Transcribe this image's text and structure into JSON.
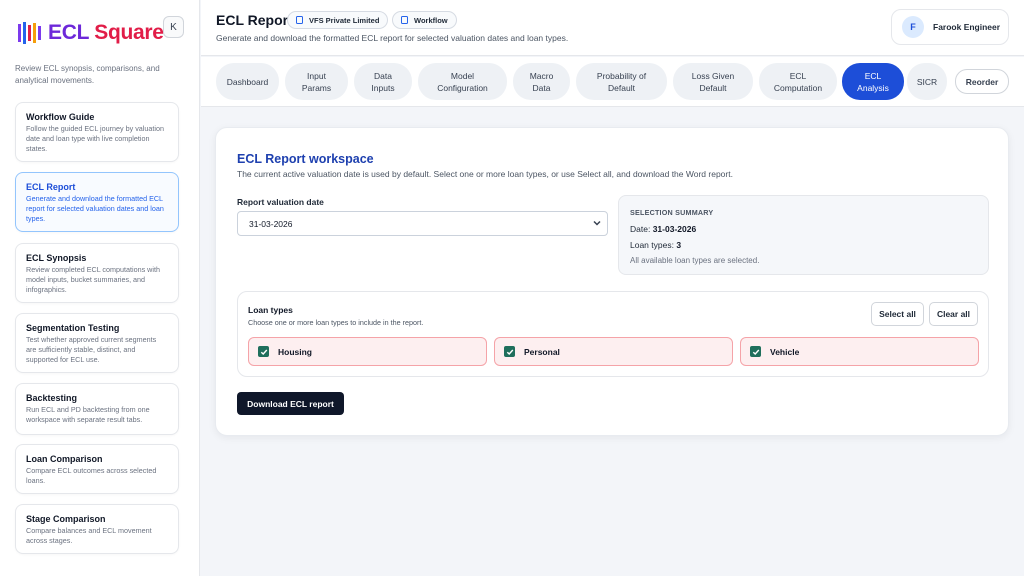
{
  "sidebar": {
    "logo": {
      "brand_a": "ECL",
      "brand_b": "Square",
      "colors": [
        "#7c3aed",
        "#2563eb",
        "#e11d48",
        "#f59e0b"
      ]
    },
    "collapse_label": "K",
    "description": "Review ECL synopsis, comparisons, and analytical movements.",
    "items": [
      {
        "title": "Workflow Guide",
        "desc": "Follow the guided ECL journey by valuation date and loan type with live completion states."
      },
      {
        "title": "ECL Report",
        "desc": "Generate and download the formatted ECL report for selected valuation dates and loan types.",
        "active": true
      },
      {
        "title": "ECL Synopsis",
        "desc": "Review completed ECL computations with model inputs, bucket summaries, and infographics."
      },
      {
        "title": "Segmentation Testing",
        "desc": "Test whether approved current segments are sufficiently stable, distinct, and supported for ECL use."
      },
      {
        "title": "Backtesting",
        "desc": "Run ECL and PD backtesting from one workspace with separate result tabs."
      },
      {
        "title": "Loan Comparison",
        "desc": "Compare ECL outcomes across selected loans."
      },
      {
        "title": "Stage Comparison",
        "desc": "Compare balances and ECL movement across stages."
      }
    ]
  },
  "header": {
    "title": "ECL Report",
    "company_pill": "VFS Private Limited",
    "workflow_pill": "Workflow",
    "subtitle": "Generate and download the formatted ECL report for selected valuation dates and loan types.",
    "user": {
      "initial": "F",
      "name": "Farook Engineer"
    }
  },
  "tabs": [
    {
      "line1": "Dashboard",
      "line2": ""
    },
    {
      "line1": "Input",
      "line2": "Params"
    },
    {
      "line1": "Data",
      "line2": "Inputs"
    },
    {
      "line1": "Model",
      "line2": "Configuration"
    },
    {
      "line1": "Macro",
      "line2": "Data"
    },
    {
      "line1": "Probability of",
      "line2": "Default"
    },
    {
      "line1": "Loss Given",
      "line2": "Default"
    },
    {
      "line1": "ECL",
      "line2": "Computation"
    },
    {
      "line1": "ECL",
      "line2": "Analysis",
      "active": true
    },
    {
      "line1": "SICR",
      "line2": ""
    }
  ],
  "reorder_label": "Reorder",
  "workspace": {
    "title": "ECL Report workspace",
    "description": "The current active valuation date is used by default. Select one or more loan types, or use Select all, and download the Word report.",
    "date_label": "Report valuation date",
    "date_value": "31-03-2026",
    "summary": {
      "title": "SELECTION SUMMARY",
      "date_prefix": "Date:",
      "date_value": "31-03-2026",
      "types_prefix": "Loan types:",
      "types_value": "3",
      "note": "All available loan types are selected."
    },
    "loan_types": {
      "title": "Loan types",
      "subtitle": "Choose one or more loan types to include in the report.",
      "select_all": "Select all",
      "clear_all": "Clear all",
      "items": [
        {
          "label": "Housing",
          "checked": true
        },
        {
          "label": "Personal",
          "checked": true
        },
        {
          "label": "Vehicle",
          "checked": true
        }
      ]
    },
    "download_label": "Download ECL report"
  }
}
